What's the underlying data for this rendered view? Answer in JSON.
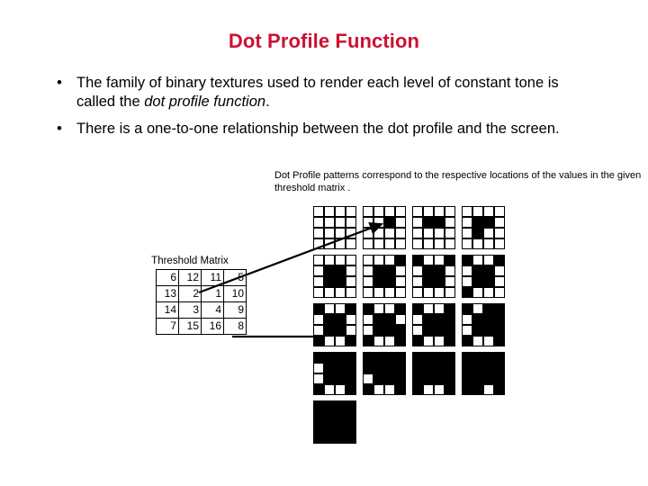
{
  "slide": {
    "title": "Dot Profile Function",
    "title_color": "#cc1133",
    "bullet_mark": "•",
    "bullets": [
      {
        "text_before": "The family of binary textures used to render each level of constant tone is called the ",
        "text_italic": "dot profile function",
        "text_after": "."
      },
      {
        "text_before": "There is a one-to-one relationship between the dot profile and the screen.",
        "text_italic": "",
        "text_after": ""
      }
    ],
    "caption": "Dot Profile patterns correspond to the respective locations of the values in the given threshold matrix .",
    "matrix": {
      "label": "Threshold Matrix",
      "rows": [
        [
          "6",
          "12",
          "11",
          "5"
        ],
        [
          "13",
          "2",
          "1",
          "10"
        ],
        [
          "14",
          "3",
          "4",
          "9"
        ],
        [
          "7",
          "15",
          "16",
          "8"
        ]
      ]
    },
    "patterns": {
      "size": 4,
      "on_color": "#000000",
      "off_color": "#ffffff",
      "grids": [
        [
          [
            0,
            0,
            0,
            0
          ],
          [
            0,
            0,
            0,
            0
          ],
          [
            0,
            0,
            0,
            0
          ],
          [
            0,
            0,
            0,
            0
          ]
        ],
        [
          [
            0,
            0,
            0,
            0
          ],
          [
            0,
            0,
            1,
            0
          ],
          [
            0,
            0,
            0,
            0
          ],
          [
            0,
            0,
            0,
            0
          ]
        ],
        [
          [
            0,
            0,
            0,
            0
          ],
          [
            0,
            1,
            1,
            0
          ],
          [
            0,
            0,
            0,
            0
          ],
          [
            0,
            0,
            0,
            0
          ]
        ],
        [
          [
            0,
            0,
            0,
            0
          ],
          [
            0,
            1,
            1,
            0
          ],
          [
            0,
            1,
            0,
            0
          ],
          [
            0,
            0,
            0,
            0
          ]
        ],
        [
          [
            0,
            0,
            0,
            0
          ],
          [
            0,
            1,
            1,
            0
          ],
          [
            0,
            1,
            1,
            0
          ],
          [
            0,
            0,
            0,
            0
          ]
        ],
        [
          [
            0,
            0,
            0,
            1
          ],
          [
            0,
            1,
            1,
            0
          ],
          [
            0,
            1,
            1,
            0
          ],
          [
            0,
            0,
            0,
            0
          ]
        ],
        [
          [
            1,
            0,
            0,
            1
          ],
          [
            0,
            1,
            1,
            0
          ],
          [
            0,
            1,
            1,
            0
          ],
          [
            0,
            0,
            0,
            0
          ]
        ],
        [
          [
            1,
            0,
            0,
            1
          ],
          [
            0,
            1,
            1,
            0
          ],
          [
            0,
            1,
            1,
            0
          ],
          [
            1,
            0,
            0,
            0
          ]
        ],
        [
          [
            1,
            0,
            0,
            1
          ],
          [
            0,
            1,
            1,
            0
          ],
          [
            0,
            1,
            1,
            0
          ],
          [
            1,
            0,
            0,
            1
          ]
        ],
        [
          [
            1,
            0,
            0,
            1
          ],
          [
            0,
            1,
            1,
            0
          ],
          [
            0,
            1,
            1,
            1
          ],
          [
            1,
            0,
            0,
            1
          ]
        ],
        [
          [
            1,
            0,
            0,
            1
          ],
          [
            0,
            1,
            1,
            1
          ],
          [
            0,
            1,
            1,
            1
          ],
          [
            1,
            0,
            0,
            1
          ]
        ],
        [
          [
            1,
            0,
            1,
            1
          ],
          [
            0,
            1,
            1,
            1
          ],
          [
            0,
            1,
            1,
            1
          ],
          [
            1,
            0,
            0,
            1
          ]
        ],
        [
          [
            1,
            1,
            1,
            1
          ],
          [
            0,
            1,
            1,
            1
          ],
          [
            0,
            1,
            1,
            1
          ],
          [
            1,
            0,
            0,
            1
          ]
        ],
        [
          [
            1,
            1,
            1,
            1
          ],
          [
            1,
            1,
            1,
            1
          ],
          [
            0,
            1,
            1,
            1
          ],
          [
            1,
            0,
            0,
            1
          ]
        ],
        [
          [
            1,
            1,
            1,
            1
          ],
          [
            1,
            1,
            1,
            1
          ],
          [
            1,
            1,
            1,
            1
          ],
          [
            1,
            0,
            0,
            1
          ]
        ],
        [
          [
            1,
            1,
            1,
            1
          ],
          [
            1,
            1,
            1,
            1
          ],
          [
            1,
            1,
            1,
            1
          ],
          [
            1,
            1,
            0,
            1
          ]
        ],
        [
          [
            1,
            1,
            1,
            1
          ],
          [
            1,
            1,
            1,
            1
          ],
          [
            1,
            1,
            1,
            1
          ],
          [
            1,
            1,
            1,
            1
          ]
        ]
      ]
    }
  }
}
